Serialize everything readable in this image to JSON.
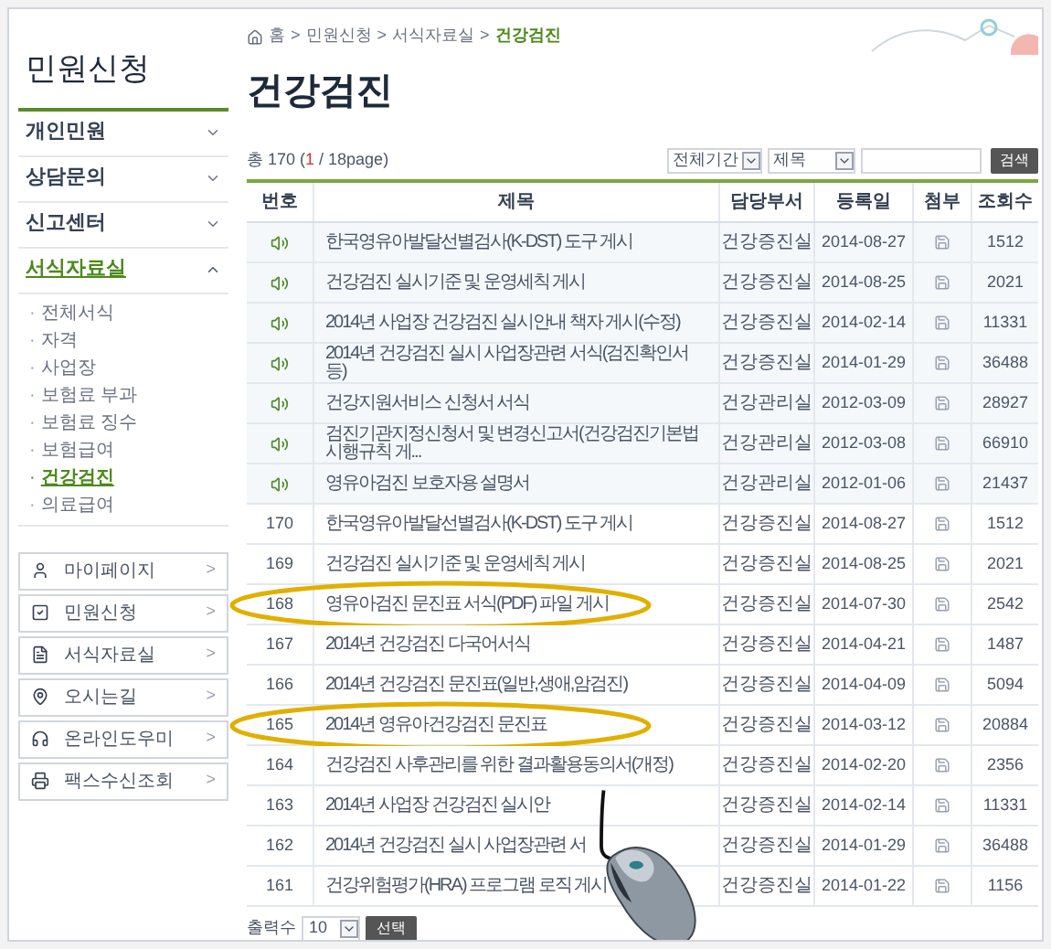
{
  "sidebar": {
    "title": "민원신청",
    "menu": [
      {
        "label": "개인민원",
        "expanded": false,
        "selected": false
      },
      {
        "label": "상담문의",
        "expanded": false,
        "selected": false
      },
      {
        "label": "신고센터",
        "expanded": false,
        "selected": false
      },
      {
        "label": "서식자료실",
        "expanded": true,
        "selected": true,
        "children": [
          {
            "label": "전체서식",
            "selected": false
          },
          {
            "label": "자격",
            "selected": false
          },
          {
            "label": "사업장",
            "selected": false
          },
          {
            "label": "보험료 부과",
            "selected": false
          },
          {
            "label": "보험료 징수",
            "selected": false
          },
          {
            "label": "보험급여",
            "selected": false
          },
          {
            "label": "건강검진",
            "selected": true
          },
          {
            "label": "의료급여",
            "selected": false
          }
        ]
      }
    ],
    "quick_links": [
      "마이페이지",
      "민원신청",
      "서식자료실",
      "오시는길",
      "온라인도우미",
      "팩스수신조회"
    ],
    "quick_link_arrow": ">",
    "submenu_bullet": "·"
  },
  "breadcrumb": [
    "홈",
    "민원신청",
    "서식자료실",
    "건강검진"
  ],
  "breadcrumb_separator": ">",
  "page_title": "건강검진",
  "summary": {
    "prefix": "총 170 (",
    "current_page": "1",
    "suffix": " / 18page)"
  },
  "filters": {
    "period": "전체기간",
    "field": "제목",
    "search_button": "검색"
  },
  "table": {
    "columns": [
      "번호",
      "제목",
      "담당부서",
      "등록일",
      "첨부",
      "조회수"
    ],
    "rows": [
      {
        "kind": "notice",
        "number": "",
        "title": "한국영유아발달선별검사(K-DST) 도구 게시",
        "dept": "건강증진실",
        "date": "2014-08-27",
        "views": "1512",
        "highlighted": false
      },
      {
        "kind": "notice",
        "number": "",
        "title": "건강검진 실시기준 및 운영세칙 게시",
        "dept": "건강증진실",
        "date": "2014-08-25",
        "views": "2021",
        "highlighted": false
      },
      {
        "kind": "notice",
        "number": "",
        "title": "2014년 사업장 건강검진 실시안내 책자 게시(수정)",
        "dept": "건강증진실",
        "date": "2014-02-14",
        "views": "11331",
        "highlighted": false
      },
      {
        "kind": "notice",
        "number": "",
        "title": "2014년 건강검진 실시 사업장관련 서식(검진확인서 등)",
        "dept": "건강증진실",
        "date": "2014-01-29",
        "views": "36488",
        "highlighted": false
      },
      {
        "kind": "notice",
        "number": "",
        "title": "건강지원서비스 신청서 서식",
        "dept": "건강관리실",
        "date": "2012-03-09",
        "views": "28927",
        "highlighted": false
      },
      {
        "kind": "notice",
        "number": "",
        "title": "검진기관지정신청서 및 변경신고서(건강검진기본법 시행규칙 게...",
        "dept": "건강관리실",
        "date": "2012-03-08",
        "views": "66910",
        "highlighted": false
      },
      {
        "kind": "notice",
        "number": "",
        "title": "영유아검진 보호자용 설명서",
        "dept": "건강관리실",
        "date": "2012-01-06",
        "views": "21437",
        "highlighted": false
      },
      {
        "kind": "post",
        "number": "170",
        "title": "한국영유아발달선별검사(K-DST) 도구 게시",
        "dept": "건강증진실",
        "date": "2014-08-27",
        "views": "1512",
        "highlighted": false
      },
      {
        "kind": "post",
        "number": "169",
        "title": "건강검진 실시기준 및 운영세칙 게시",
        "dept": "건강증진실",
        "date": "2014-08-25",
        "views": "2021",
        "highlighted": false
      },
      {
        "kind": "post",
        "number": "168",
        "title": "영유아검진 문진표 서식(PDF) 파일 게시",
        "dept": "건강증진실",
        "date": "2014-07-30",
        "views": "2542",
        "highlighted": true
      },
      {
        "kind": "post",
        "number": "167",
        "title": "2014년 건강검진 다국어서식",
        "dept": "건강증진실",
        "date": "2014-04-21",
        "views": "1487",
        "highlighted": false
      },
      {
        "kind": "post",
        "number": "166",
        "title": "2014년 건강검진 문진표(일반,생애,암검진)",
        "dept": "건강증진실",
        "date": "2014-04-09",
        "views": "5094",
        "highlighted": false
      },
      {
        "kind": "post",
        "number": "165",
        "title": "2014년 영유아건강검진 문진표",
        "dept": "건강증진실",
        "date": "2014-03-12",
        "views": "20884",
        "highlighted": true
      },
      {
        "kind": "post",
        "number": "164",
        "title": "건강검진 사후관리를 위한 결과활용동의서(개정)",
        "dept": "건강증진실",
        "date": "2014-02-20",
        "views": "2356",
        "highlighted": false
      },
      {
        "kind": "post",
        "number": "163",
        "title": "2014년 사업장 건강검진 실시안",
        "dept": "건강증진실",
        "date": "2014-02-14",
        "views": "11331",
        "highlighted": false
      },
      {
        "kind": "post",
        "number": "162",
        "title": "2014년 건강검진 실시 사업장관련 서",
        "dept": "건강증진실",
        "date": "2014-01-29",
        "views": "36488",
        "highlighted": false
      },
      {
        "kind": "post",
        "number": "161",
        "title": "건강위험평가(HRA) 프로그램 로직 게시",
        "dept": "건강증진실",
        "date": "2014-01-22",
        "views": "1156",
        "highlighted": false
      }
    ]
  },
  "footer": {
    "label": "출력수",
    "page_size": "10",
    "select_button": "선택"
  }
}
